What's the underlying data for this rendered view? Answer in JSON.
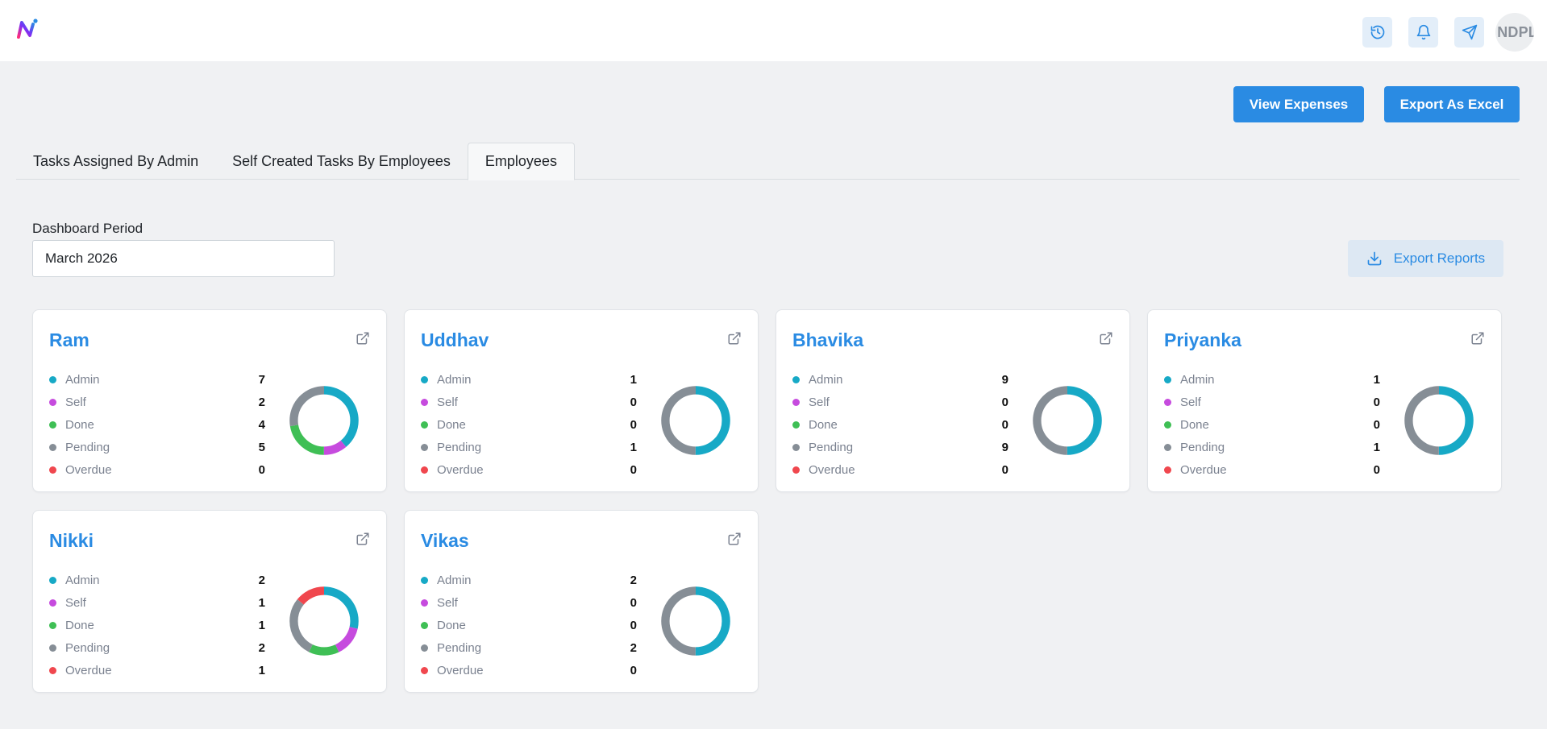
{
  "header": {
    "logo": "n-logo",
    "icons": [
      "history-icon",
      "bell-icon",
      "send-icon"
    ],
    "avatar_text": "NDPL"
  },
  "actions": {
    "view_expenses": "View Expenses",
    "export_excel": "Export As Excel",
    "export_reports": "Export Reports"
  },
  "tabs": [
    {
      "label": "Tasks Assigned By Admin",
      "active": false
    },
    {
      "label": "Self Created Tasks By Employees",
      "active": false
    },
    {
      "label": "Employees",
      "active": true
    }
  ],
  "filter": {
    "label": "Dashboard Period",
    "value": "March 2026"
  },
  "legend": {
    "admin": "Admin",
    "self": "Self",
    "done": "Done",
    "pending": "Pending",
    "overdue": "Overdue"
  },
  "colors": {
    "admin": "#17a9c6",
    "self": "#c64bde",
    "done": "#3fbf55",
    "pending": "#868e96",
    "overdue": "#f0474e",
    "accent": "#2a8be3"
  },
  "employees": [
    {
      "name": "Ram",
      "admin": 7,
      "self": 2,
      "done": 4,
      "pending": 5,
      "overdue": 0
    },
    {
      "name": "Uddhav",
      "admin": 1,
      "self": 0,
      "done": 0,
      "pending": 1,
      "overdue": 0
    },
    {
      "name": "Bhavika",
      "admin": 9,
      "self": 0,
      "done": 0,
      "pending": 9,
      "overdue": 0
    },
    {
      "name": "Priyanka",
      "admin": 1,
      "self": 0,
      "done": 0,
      "pending": 1,
      "overdue": 0
    },
    {
      "name": "Nikki",
      "admin": 2,
      "self": 1,
      "done": 1,
      "pending": 2,
      "overdue": 1
    },
    {
      "name": "Vikas",
      "admin": 2,
      "self": 0,
      "done": 0,
      "pending": 2,
      "overdue": 0
    }
  ]
}
